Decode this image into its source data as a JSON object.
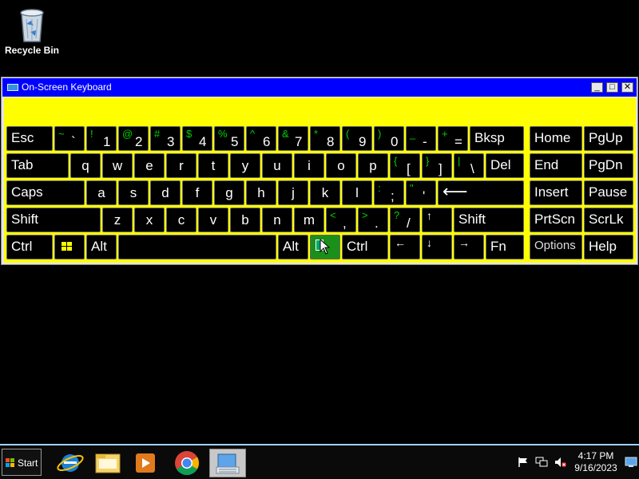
{
  "desktop": {
    "recycle_bin_label": "Recycle Bin"
  },
  "window": {
    "title": "On-Screen Keyboard",
    "minimize": "_",
    "maximize": "□",
    "close": "✕"
  },
  "keys": {
    "esc": "Esc",
    "tab": "Tab",
    "caps": "Caps",
    "shift_left": "Shift",
    "shift_right": "Shift",
    "ctrl_left": "Ctrl",
    "ctrl_right": "Ctrl",
    "alt_left": "Alt",
    "alt_right": "Alt",
    "bksp": "Bksp",
    "del": "Del",
    "fn": "Fn",
    "options": "Options",
    "home": "Home",
    "pgup": "PgUp",
    "end": "End",
    "pgdn": "PgDn",
    "insert": "Insert",
    "pause": "Pause",
    "prtscn": "PrtScn",
    "scrlk": "ScrLk",
    "help": "Help",
    "enter_glyph": "⟵",
    "arrow_up": "↑",
    "arrow_left": "←",
    "arrow_down": "↓",
    "arrow_right": "→",
    "q": "q",
    "w": "w",
    "e": "e",
    "r": "r",
    "t": "t",
    "y": "y",
    "u": "u",
    "i": "i",
    "o": "o",
    "p": "p",
    "a": "a",
    "s": "s",
    "d": "d",
    "f": "f",
    "g": "g",
    "h": "h",
    "j": "j",
    "k": "k",
    "l": "l",
    "z": "z",
    "x": "x",
    "c": "c",
    "v": "v",
    "b": "b",
    "n": "n",
    "m": "m",
    "num_row": [
      {
        "shift": "~",
        "main": "`"
      },
      {
        "shift": "!",
        "main": "1"
      },
      {
        "shift": "@",
        "main": "2"
      },
      {
        "shift": "#",
        "main": "3"
      },
      {
        "shift": "$",
        "main": "4"
      },
      {
        "shift": "%",
        "main": "5"
      },
      {
        "shift": "^",
        "main": "6"
      },
      {
        "shift": "&",
        "main": "7"
      },
      {
        "shift": "*",
        "main": "8"
      },
      {
        "shift": "(",
        "main": "9"
      },
      {
        "shift": ")",
        "main": "0"
      },
      {
        "shift": "_",
        "main": "-"
      },
      {
        "shift": "+",
        "main": "="
      }
    ],
    "brackets": [
      {
        "shift": "{",
        "main": "["
      },
      {
        "shift": "}",
        "main": "]"
      },
      {
        "shift": "|",
        "main": "\\"
      }
    ],
    "semi": [
      {
        "shift": ":",
        "main": ";"
      },
      {
        "shift": "\"",
        "main": "'"
      }
    ],
    "punct": [
      {
        "shift": "<",
        "main": ","
      },
      {
        "shift": ">",
        "main": "."
      },
      {
        "shift": "?",
        "main": "/"
      }
    ]
  },
  "taskbar": {
    "start_label": "Start",
    "time": "4:17 PM",
    "date": "9/16/2023"
  },
  "colors": {
    "keyboard_bg": "#ffff00",
    "titlebar": "#0000ff",
    "shift_legend": "#00d000",
    "key_bg": "#000000"
  }
}
